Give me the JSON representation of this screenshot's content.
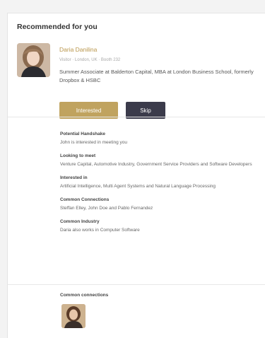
{
  "card": {
    "heading": "Recommended for you"
  },
  "profile": {
    "name": "Daria Danilina",
    "meta": "Visitor · London, UK · Booth 232",
    "bio": "Summer Associate at Balderton Capital, MBA at London Business School, formerly Dropbox & HSBC",
    "interested_label": "Interested",
    "skip_label": "Skip"
  },
  "details": [
    {
      "title": "Potential Handshake",
      "body": "John is interested in meeting you"
    },
    {
      "title": "Looking to meet",
      "body": "Venture Capital, Automotive Industry, Government Service Providers and Software Developers"
    },
    {
      "title": "Interested in",
      "body": "Artificial Intelligence, Multi Agent Systems and Natural Language Processing"
    },
    {
      "title": "Common Connections",
      "body": "Steffan Elley, John Doe and Pablo Fernandez"
    },
    {
      "title": "Common Industry",
      "body": "Daria also works in Computer Software"
    }
  ],
  "common_connections": {
    "title": "Common connections"
  },
  "colors": {
    "accent_gold": "#c0a35f",
    "skip_dark": "#3b3b4b"
  }
}
